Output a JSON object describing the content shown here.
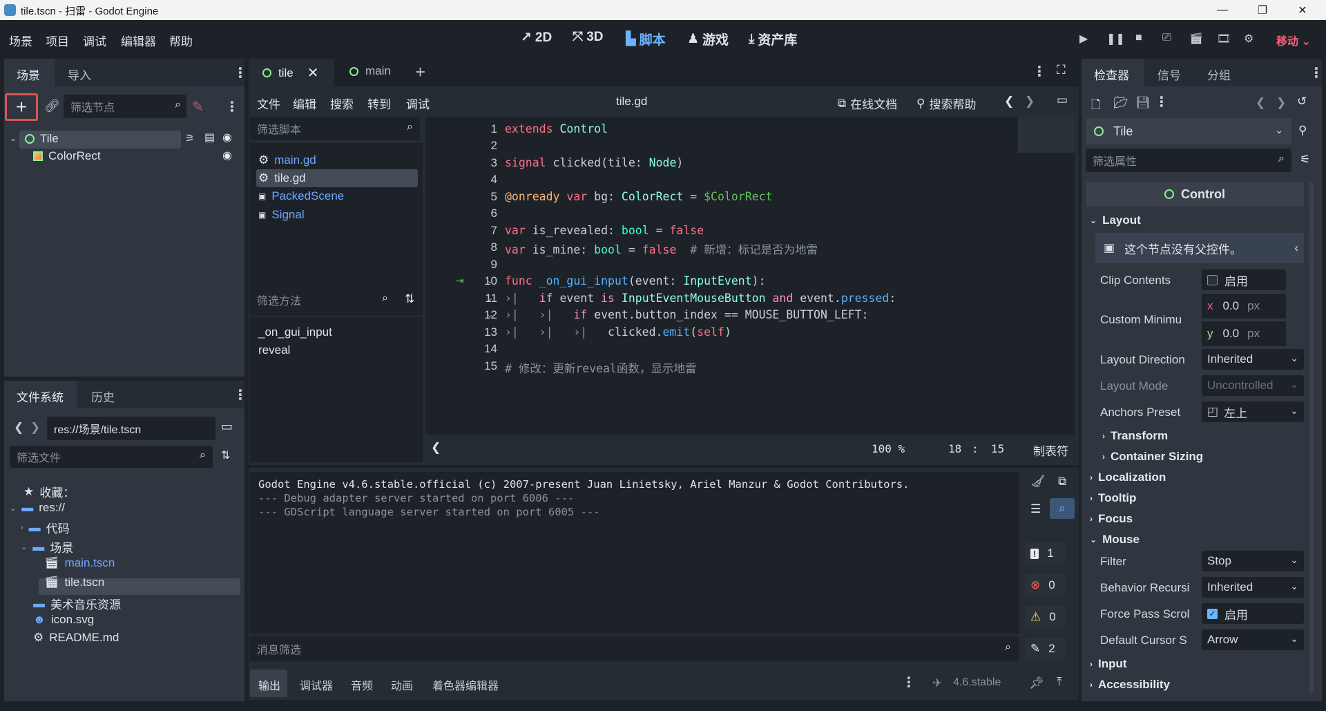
{
  "window": {
    "title": "tile.tscn - 扫雷 - Godot Engine"
  },
  "menu": [
    "场景",
    "项目",
    "调试",
    "编辑器",
    "帮助"
  ],
  "modes": [
    {
      "label": "2D",
      "icon": "2d-icon"
    },
    {
      "label": "3D",
      "icon": "3d-icon"
    },
    {
      "label": "脚本",
      "icon": "script-icon",
      "active": true
    },
    {
      "label": "游戏",
      "icon": "game-icon"
    },
    {
      "label": "资产库",
      "icon": "assetlib-icon"
    }
  ],
  "renderer": "移动",
  "scene_dock": {
    "tabs": [
      "场景",
      "导入"
    ],
    "filter_placeholder": "筛选节点",
    "nodes": [
      {
        "label": "Tile",
        "icon": "control-node-icon"
      },
      {
        "label": "ColorRect",
        "icon": "colorrect-icon"
      }
    ]
  },
  "fs_dock": {
    "tabs": [
      "文件系统",
      "历史"
    ],
    "path": "res://场景/tile.tscn",
    "filter_placeholder": "筛选文件",
    "items": {
      "favorites": "收藏：",
      "root": "res://",
      "code": "代码",
      "scenes": "场景",
      "main": "main.tscn",
      "tile": "tile.tscn",
      "art": "美术音乐资源",
      "icon": "icon.svg",
      "readme": "README.md"
    }
  },
  "editor_tabs": [
    "tile",
    "main"
  ],
  "script_menu": [
    "文件",
    "编辑",
    "搜索",
    "转到",
    "调试"
  ],
  "script_file": "tile.gd",
  "online_docs": "在线文档",
  "search_help": "搜索帮助",
  "script_list": {
    "filter_placeholder": "筛选脚本",
    "items": [
      "main.gd",
      "tile.gd",
      "PackedScene",
      "Signal"
    ],
    "method_filter_placeholder": "筛选方法",
    "methods": [
      "_on_gui_input",
      "reveal"
    ]
  },
  "code": {
    "l1a": "extends",
    "l1b": " Control",
    "l3a": "signal",
    "l3b": " clicked",
    "l3c": "(tile: ",
    "l3d": "Node",
    "l3e": ")",
    "l5a": "@onready",
    "l5b": " var",
    "l5c": " bg: ",
    "l5d": "ColorRect",
    "l5e": " = ",
    "l5f": "$ColorRect",
    "l7a": "var",
    "l7b": " is_revealed: ",
    "l7c": "bool",
    "l7d": " = ",
    "l7e": "false",
    "l8a": "var",
    "l8b": " is_mine: ",
    "l8c": "bool",
    "l8d": " = ",
    "l8e": "false",
    "l8f": "  # 新增：标记是否为地雷",
    "l10a": "func",
    "l10b": " _on_gui_input",
    "l10c": "(event: ",
    "l10d": "InputEvent",
    "l10e": "):",
    "l11a": "if",
    "l11b": " event ",
    "l11c": "is",
    "l11d": " InputEventMouseButton ",
    "l11e": "and",
    "l11f": " event.",
    "l11g": "pressed",
    ":": ":",
    "l12a": "if",
    "l12b": " event.button_index == MOUSE_BUTTON_LEFT:",
    "l13a": "clicked.",
    "l13b": "emit",
    "l13c": "(",
    "l13d": "self",
    "l13e": ")",
    "l15": "# 修改：更新reveal函数，显示地雷"
  },
  "line_numbers": [
    "1",
    "2",
    "3",
    "4",
    "5",
    "6",
    "7",
    "8",
    "9",
    "10",
    "11",
    "12",
    "13",
    "14",
    "15"
  ],
  "status": {
    "zoom": "100 %",
    "line": "18",
    "col": "15",
    "sep": ":",
    "indent": "制表符"
  },
  "output": {
    "lines": [
      "Godot Engine v4.6.stable.official (c) 2007-present Juan Linietsky, Ariel Manzur & Godot Contributors.",
      "--- Debug adapter server started on port 6006 ---",
      "--- GDScript language server started on port 6005 ---"
    ],
    "filter_placeholder": "消息筛选",
    "counts": {
      "messages": "1",
      "errors": "0",
      "warnings": "0",
      "editor": "2"
    }
  },
  "bottom_tabs": [
    "输出",
    "调试器",
    "音频",
    "动画",
    "着色器编辑器"
  ],
  "version": "4.6.stable",
  "inspector": {
    "tabs": [
      "检查器",
      "信号",
      "分组"
    ],
    "node": "Tile",
    "filter_placeholder": "筛选属性",
    "class": "Control",
    "layout": "Layout",
    "no_parent": "这个节点没有父控件。",
    "clip_contents": "Clip Contents",
    "enable": "启用",
    "custom_min": "Custom Minimu",
    "x_label": "x",
    "y_label": "y",
    "x_val": "0.0",
    "y_val": "0.0",
    "unit": "px",
    "layout_dir": "Layout Direction",
    "layout_dir_val": "Inherited",
    "layout_mode": "Layout Mode",
    "layout_mode_val": "Uncontrolled",
    "anchors": "Anchors Preset",
    "anchors_val": "左上",
    "transform": "Transform",
    "container": "Container Sizing",
    "localization": "Localization",
    "tooltip": "Tooltip",
    "focus": "Focus",
    "mouse": "Mouse",
    "filter": "Filter",
    "filter_val": "Stop",
    "behavior": "Behavior Recursi",
    "behavior_val": "Inherited",
    "force_pass": "Force Pass Scrol",
    "force_val": "启用",
    "cursor": "Default Cursor S",
    "cursor_val": "Arrow",
    "input": "Input",
    "accessibility": "Accessibility"
  },
  "colors": {
    "accent": "#6cb4ff",
    "renderer": "#ff5d7a",
    "node_green": "#8eef97",
    "highlight_red": "#e05252"
  }
}
